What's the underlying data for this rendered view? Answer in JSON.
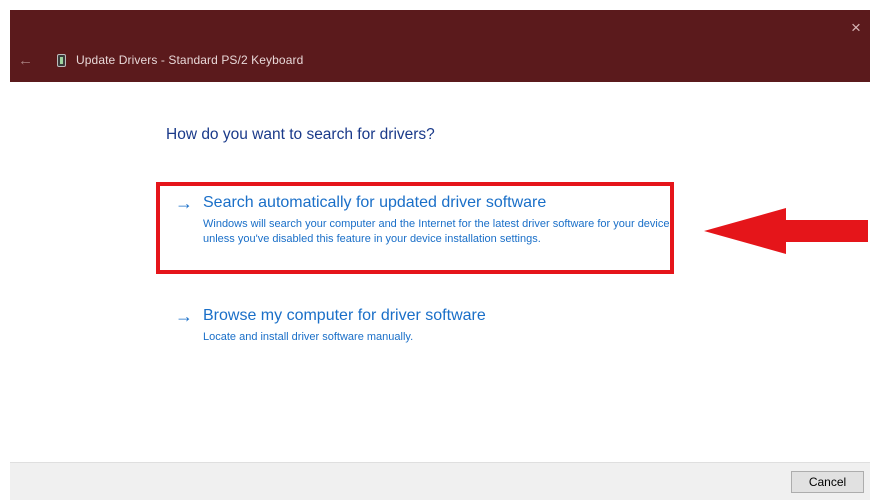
{
  "window": {
    "title": "Update Drivers - Standard PS/2 Keyboard",
    "close_icon": "×",
    "back_icon": "←"
  },
  "main": {
    "heading": "How do you want to search for drivers?",
    "options": [
      {
        "arrow": "→",
        "title": "Search automatically for updated driver software",
        "description": "Windows will search your computer and the Internet for the latest driver software for your device, unless you've disabled this feature in your device installation settings."
      },
      {
        "arrow": "→",
        "title": "Browse my computer for driver software",
        "description": "Locate and install driver software manually."
      }
    ]
  },
  "footer": {
    "cancel_label": "Cancel"
  },
  "colors": {
    "title_bar": "#5b1a1c",
    "link_blue": "#1a6fc8",
    "heading_blue": "#1a3a8a",
    "annotation_red": "#e5151a"
  }
}
